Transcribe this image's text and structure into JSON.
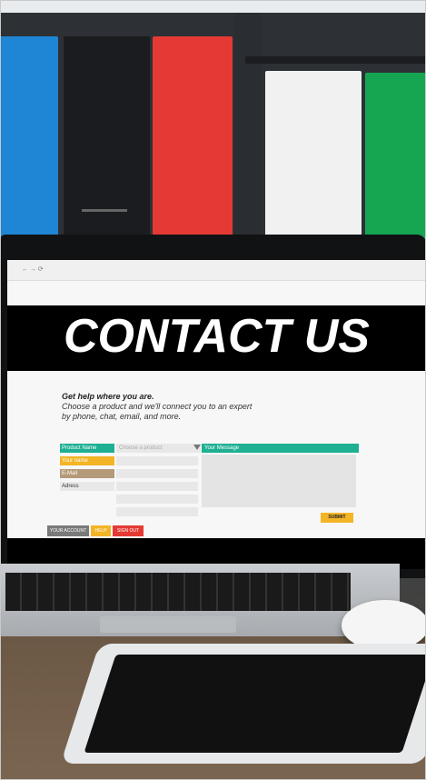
{
  "screen": {
    "hero_title": "CONTACT US",
    "help_heading": "Get help where you are.",
    "help_text": "Choose a product and we'll connect you to an expert by phone, chat, email, and more.",
    "form": {
      "labels": [
        "Product Name",
        "Your name",
        "E-Mail",
        "Adress"
      ],
      "product_placeholder": "Choose a product",
      "message_label": "Your Message",
      "submit_label": "SUBMIT"
    },
    "footer_buttons": [
      "YOUR ACCOUNT",
      "HELP",
      "SIGN OUT"
    ]
  },
  "colors": {
    "teal": "#1fb093",
    "yellow": "#f3b526",
    "red": "#e53a34",
    "blue_binder": "#1f86d6",
    "green_binder": "#16a652"
  }
}
